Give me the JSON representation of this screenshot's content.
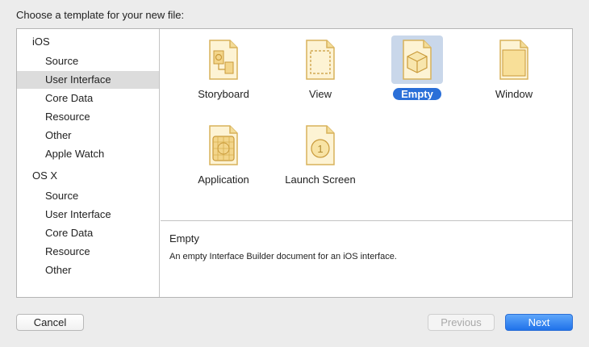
{
  "prompt": "Choose a template for your new file:",
  "sidebar": {
    "groups": [
      {
        "title": "iOS",
        "items": [
          "Source",
          "User Interface",
          "Core Data",
          "Resource",
          "Other",
          "Apple Watch"
        ]
      },
      {
        "title": "OS X",
        "items": [
          "Source",
          "User Interface",
          "Core Data",
          "Resource",
          "Other"
        ]
      }
    ],
    "selected": "iOS / User Interface"
  },
  "templates": [
    {
      "label": "Storyboard",
      "icon": "storyboard-icon"
    },
    {
      "label": "View",
      "icon": "view-icon"
    },
    {
      "label": "Empty",
      "icon": "empty-cube-icon",
      "selected": true
    },
    {
      "label": "Window",
      "icon": "window-icon"
    },
    {
      "label": "Application",
      "icon": "application-icon"
    },
    {
      "label": "Launch Screen",
      "icon": "launch-screen-icon"
    }
  ],
  "description": {
    "title": "Empty",
    "text": "An empty Interface Builder document for an iOS interface."
  },
  "buttons": {
    "cancel": "Cancel",
    "previous": "Previous",
    "next": "Next"
  },
  "colors": {
    "accent": "#2a6fd8",
    "selection_tile": "#c9d7ea",
    "icon_fill": "#fbe9b7",
    "icon_stroke": "#d8b25a"
  }
}
